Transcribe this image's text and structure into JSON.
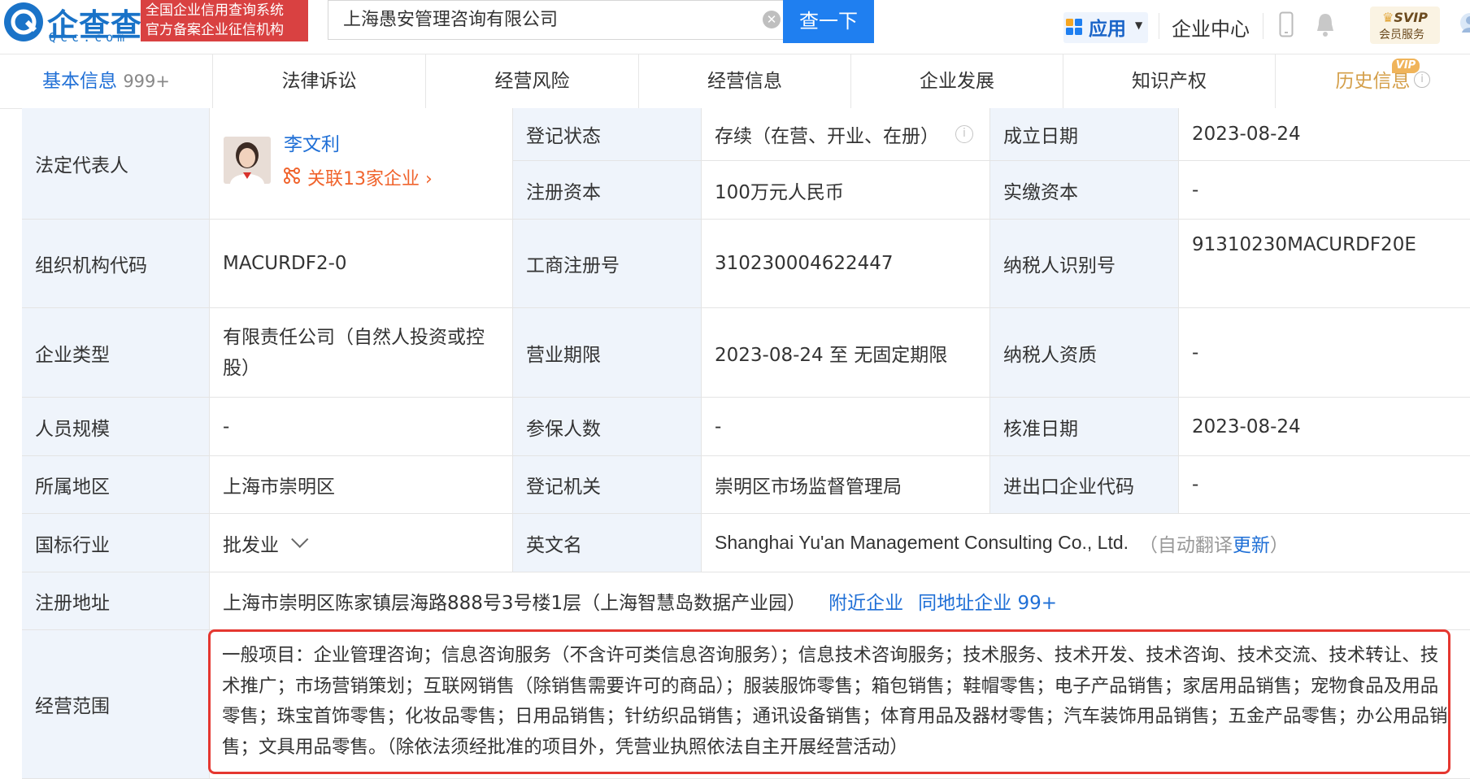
{
  "header": {
    "logo_text": "企查查",
    "logo_sub": "Qcc.com",
    "badge_line1": "全国企业信用查询系统",
    "badge_line2": "官方备案企业征信机构",
    "search_value": "上海愚安管理咨询有限公司",
    "search_button": "查一下",
    "apps_label": "应用",
    "enterprise_center": "企业中心",
    "svip_label": "SVIP",
    "svip_sub": "会员服务"
  },
  "tabs": [
    {
      "label": "基本信息",
      "count": "999+"
    },
    {
      "label": "法律诉讼"
    },
    {
      "label": "经营风险"
    },
    {
      "label": "经营信息"
    },
    {
      "label": "企业发展"
    },
    {
      "label": "知识产权"
    },
    {
      "label": "历史信息",
      "tag": "VIP"
    }
  ],
  "info": {
    "legal_rep_label": "法定代表人",
    "legal_rep_name": "李文利",
    "legal_rep_assoc": "关联13家企业",
    "reg_status_label": "登记状态",
    "reg_status": "存续（在营、开业、在册）",
    "founded_label": "成立日期",
    "founded": "2023-08-24",
    "reg_capital_label": "注册资本",
    "reg_capital": "100万元人民币",
    "paid_capital_label": "实缴资本",
    "paid_capital": "-",
    "org_code_label": "组织机构代码",
    "org_code": "MACURDF2-0",
    "biz_reg_no_label": "工商注册号",
    "biz_reg_no": "310230004622447",
    "taxpayer_id_label": "纳税人识别号",
    "taxpayer_id": "91310230MACURDF20E",
    "company_type_label": "企业类型",
    "company_type": "有限责任公司（自然人投资或控股）",
    "biz_term_label": "营业期限",
    "biz_term": "2023-08-24 至 无固定期限",
    "taxpayer_qual_label": "纳税人资质",
    "taxpayer_qual": "-",
    "staff_size_label": "人员规模",
    "staff_size": "-",
    "insured_label": "参保人数",
    "insured": "-",
    "approval_date_label": "核准日期",
    "approval_date": "2023-08-24",
    "region_label": "所属地区",
    "region": "上海市崇明区",
    "reg_authority_label": "登记机关",
    "reg_authority": "崇明区市场监督管理局",
    "import_export_label": "进出口企业代码",
    "import_export": "-",
    "industry_label": "国标行业",
    "industry": "批发业",
    "english_name_label": "英文名",
    "english_name": "Shanghai Yu'an Management Consulting Co., Ltd.",
    "auto_translate": "（自动翻译",
    "update_link": "更新",
    "auto_translate_end": "）",
    "address_label": "注册地址",
    "address": "上海市崇明区陈家镇层海路888号3号楼1层（上海智慧岛数据产业园）",
    "nearby_link": "附近企业",
    "same_address_link": "同地址企业 99+",
    "scope_label": "经营范围",
    "scope": "一般项目：企业管理咨询；信息咨询服务（不含许可类信息咨询服务）；信息技术咨询服务；技术服务、技术开发、技术咨询、技术交流、技术转让、技术推广；市场营销策划；互联网销售（除销售需要许可的商品）；服装服饰零售；箱包销售；鞋帽零售；电子产品销售；家居用品销售；宠物食品及用品零售；珠宝首饰零售；化妆品零售；日用品销售；针纺织品销售；通讯设备销售；体育用品及器材零售；汽车装饰用品销售；五金产品零售；办公用品销售；文具用品零售。（除依法须经批准的项目外，凭营业执照依法自主开展经营活动）"
  },
  "colors": {
    "brand_blue": "#1f7ff0",
    "badge_red": "#d94141",
    "label_bg": "#eff4fb",
    "link_blue": "#1f6fd6",
    "assoc_orange": "#f0642d",
    "highlight_red": "#e53730"
  }
}
